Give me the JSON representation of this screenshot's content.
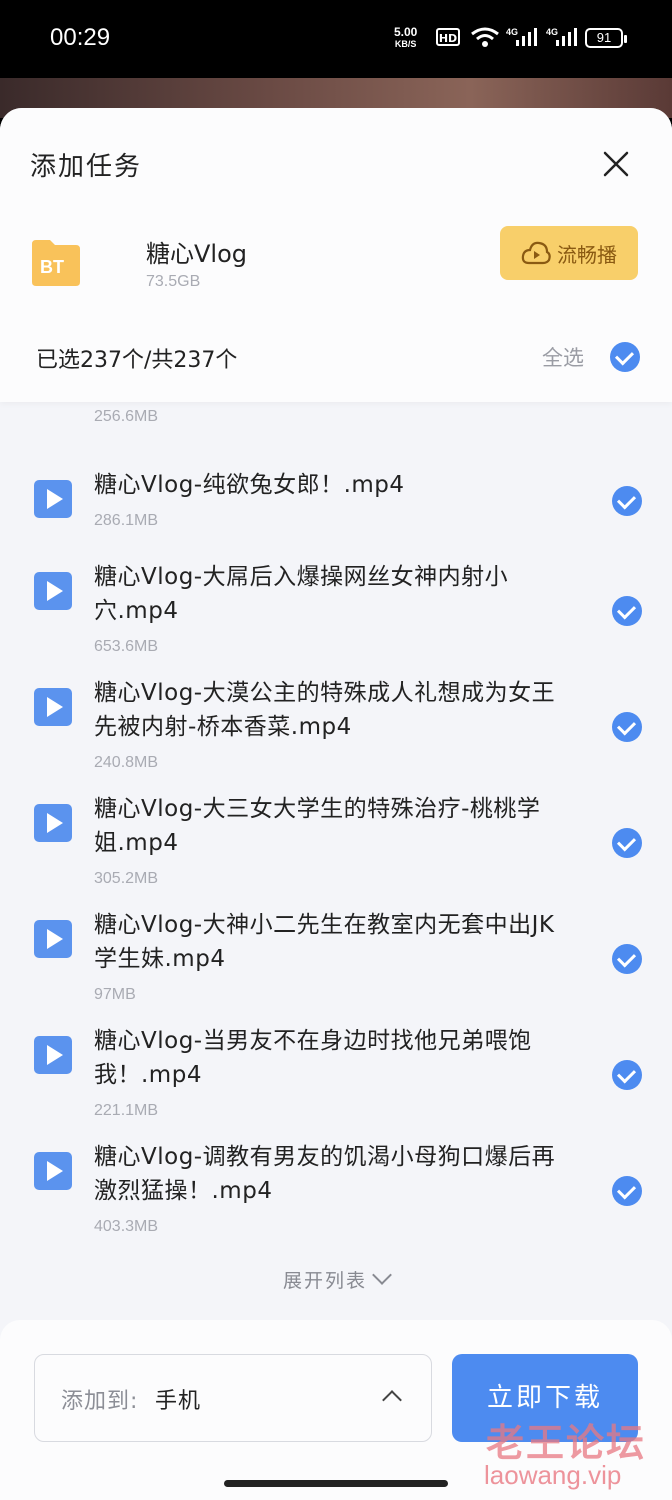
{
  "status": {
    "time": "00:29",
    "speed_value": "5.00",
    "speed_unit": "KB/S",
    "hd": "HD",
    "battery": "91"
  },
  "header": {
    "title": "添加任务",
    "torrent_icon_text": "BT",
    "torrent_name": "糖心Vlog",
    "torrent_size": "73.5GB",
    "play_button": "流畅播",
    "selected_text": "已选237个/共237个",
    "select_all": "全选"
  },
  "list": {
    "cut_item_size": "256.6MB",
    "items": [
      {
        "name": "糖心Vlog-纯欲兔女郎！.mp4",
        "size": "286.1MB"
      },
      {
        "name": "糖心Vlog-大屌后入爆操网丝女神内射小穴.mp4",
        "size": "653.6MB"
      },
      {
        "name": "糖心Vlog-大漠公主的特殊成人礼想成为女王先被内射-桥本香菜.mp4",
        "size": "240.8MB"
      },
      {
        "name": "糖心Vlog-大三女大学生的特殊治疗-桃桃学姐.mp4",
        "size": "305.2MB"
      },
      {
        "name": "糖心Vlog-大神小二先生在教室内无套中出JK学生妹.mp4",
        "size": "97MB"
      },
      {
        "name": "糖心Vlog-当男友不在身边时找他兄弟喂饱我！.mp4",
        "size": "221.1MB"
      },
      {
        "name": "糖心Vlog-调教有男友的饥渴小母狗口爆后再激烈猛操！.mp4",
        "size": "403.3MB"
      }
    ],
    "expand": "展开列表"
  },
  "footer": {
    "dest_label": "添加到:",
    "dest_value": "手机",
    "download": "立即下载"
  },
  "watermark": {
    "line1": "老王论坛",
    "line2": "laowang.vip"
  },
  "colors": {
    "accent": "#4d8bf0",
    "play_button": "#f8cf6a",
    "bt_icon": "#f9c25a"
  }
}
